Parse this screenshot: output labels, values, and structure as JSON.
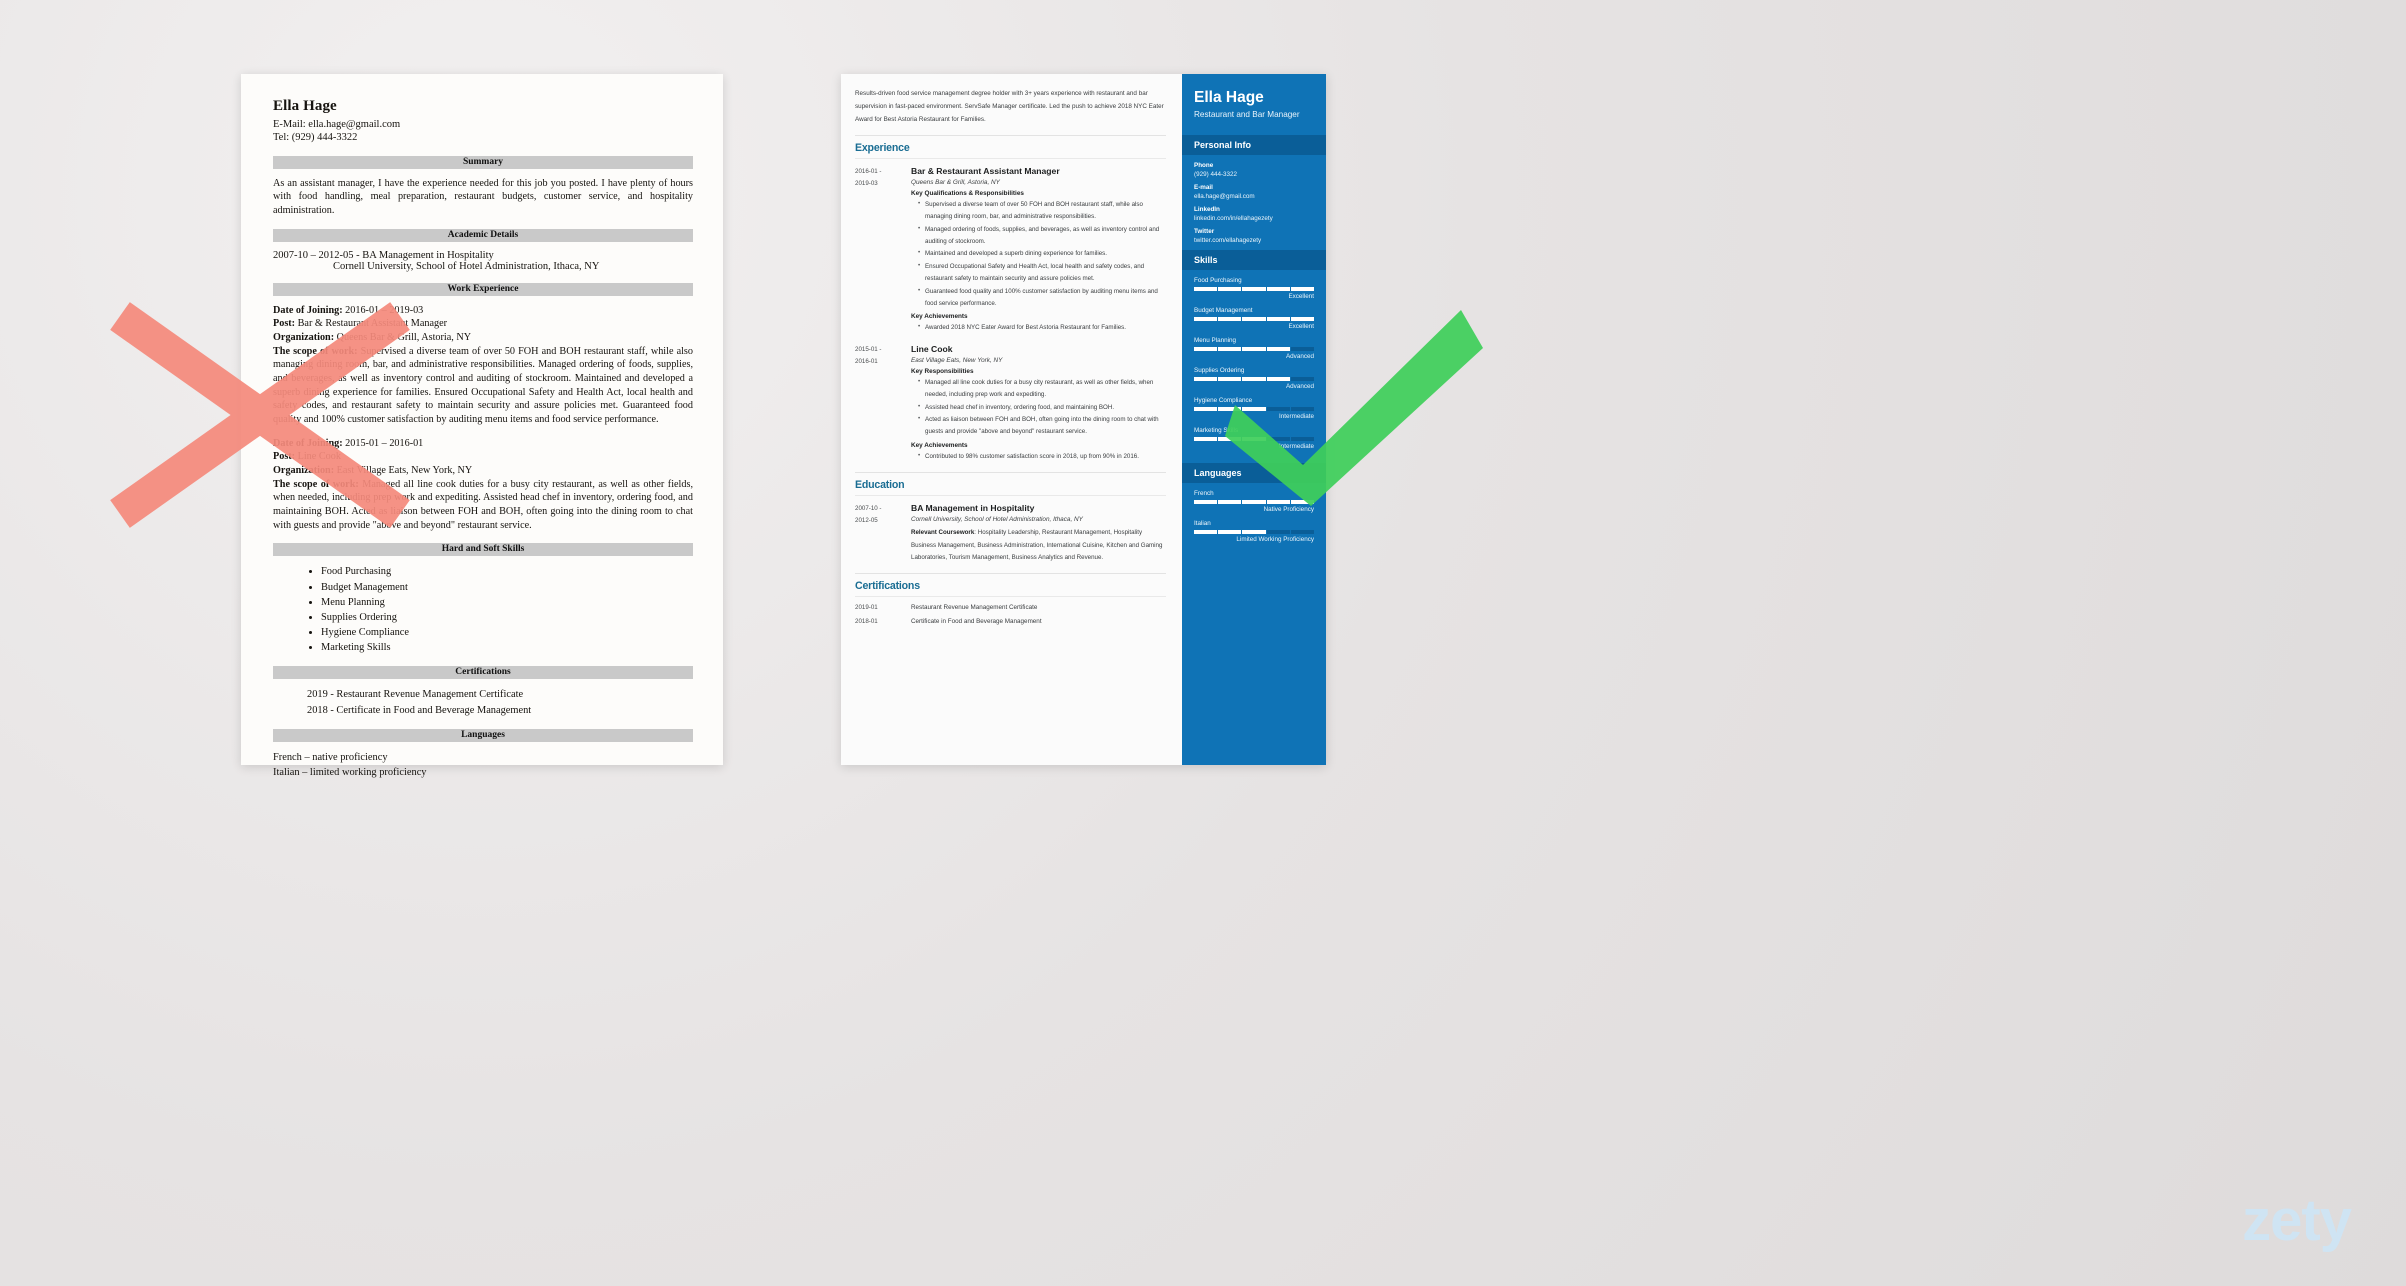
{
  "brand": {
    "wordmark": "zety",
    "color": "#cfe4f3"
  },
  "marks": {
    "reject": {
      "name": "red-x-mark",
      "color": "#f58a7c"
    },
    "approve": {
      "name": "green-check-mark",
      "color": "#3ecf5a"
    }
  },
  "bad_resume": {
    "name": "Ella Hage",
    "email_line": "E-Mail: ella.hage@gmail.com",
    "phone_line": "Tel: (929) 444-3322",
    "sections": {
      "summary": {
        "heading": "Summary",
        "text": "As an assistant manager, I have the experience needed for this job you posted. I have plenty of hours with food handling, meal preparation, restaurant budgets, customer service, and hospitality administration."
      },
      "academic": {
        "heading": "Academic Details",
        "line": "2007-10 – 2012-05  - BA Management in Hospitality",
        "sub": "Cornell University, School of Hotel Administration, Ithaca, NY"
      },
      "work": {
        "heading": "Work Experience",
        "jobs": [
          {
            "date_label": "Date of Joining:",
            "date_value": " 2016-01 – 2019-03",
            "post_label": "Post:",
            "post_value": " Bar & Restaurant Assistant Manager",
            "org_label": "Organization:",
            "org_value": " Queens Bar & Grill, Astoria, NY",
            "scope_label": "The scope of work:",
            "scope_value": " Supervised a diverse team of over 50 FOH and BOH restaurant staff, while also managing dining room, bar, and administrative responsibilities. Managed ordering of foods, supplies, and beverages, as well as inventory control and auditing of stockroom. Maintained and developed a superb dining experience for families. Ensured Occupational Safety and Health Act, local health and safety codes, and restaurant safety to maintain security and assure policies met. Guaranteed food quality and 100% customer satisfaction by auditing menu items and food service performance."
          },
          {
            "date_label": "Date of Joining:",
            "date_value": " 2015-01 – 2016-01",
            "post_label": "Post:",
            "post_value": " Line Cook",
            "org_label": "Organization:",
            "org_value": " East Village Eats, New York, NY",
            "scope_label": "The scope of work:",
            "scope_value": " Managed all line cook duties for a busy city restaurant, as well as other fields, when needed, including prep work and expediting. Assisted head chef in inventory, ordering food, and maintaining BOH. Acted as liaison between FOH and BOH, often going into the dining room to chat with guests and provide \"above and beyond\" restaurant service."
          }
        ]
      },
      "skills": {
        "heading": "Hard and Soft Skills",
        "items": [
          "Food Purchasing",
          "Budget Management",
          "Menu Planning",
          "Supplies Ordering",
          "Hygiene Compliance",
          "Marketing Skills"
        ]
      },
      "certifications": {
        "heading": "Certifications",
        "items": [
          "2019 - Restaurant Revenue Management Certificate",
          "2018 - Certificate in Food and Beverage Management"
        ]
      },
      "languages": {
        "heading": "Languages",
        "items": [
          "French – native proficiency",
          "Italian – limited working proficiency"
        ]
      }
    }
  },
  "good_resume": {
    "summary": "Results-driven food service management degree holder with 3+ years experience with restaurant and bar supervision in fast-paced environment. ServSafe Manager certificate. Led the push to achieve 2018 NYC Eater Award for Best Astoria Restaurant for Families.",
    "experience": {
      "heading": "Experience",
      "entries": [
        {
          "dates": "2016-01 -\n2019-03",
          "title": "Bar & Restaurant Assistant Manager",
          "org": "Queens Bar & Grill, Astoria, NY",
          "group1_head": "Key Qualifications & Responsibilities",
          "group1": [
            "Supervised a diverse team of over 50 FOH and BOH restaurant staff, while also managing dining room, bar, and administrative responsibilities.",
            "Managed ordering of foods, supplies, and beverages, as well as inventory control and auditing of stockroom.",
            "Maintained and developed a superb dining experience for families.",
            "Ensured Occupational Safety and Health Act, local health and safety codes, and restaurant safety to maintain security and assure policies met.",
            "Guaranteed food quality and 100% customer satisfaction by auditing menu items and food service performance."
          ],
          "group2_head": "Key Achievements",
          "group2": [
            "Awarded 2018 NYC Eater Award for Best Astoria Restaurant for Families."
          ]
        },
        {
          "dates": "2015-01 -\n2016-01",
          "title": "Line Cook",
          "org": "East Village Eats, New York, NY",
          "group1_head": "Key Responsibilities",
          "group1": [
            "Managed all line cook duties for a busy city restaurant, as well as other fields, when needed, including prep work and expediting.",
            "Assisted head chef in inventory, ordering food, and maintaining BOH.",
            "Acted as liaison between FOH and BOH, often going into the dining room to chat with guests and provide \"above and beyond\" restaurant service."
          ],
          "group2_head": "Key Achievements",
          "group2": [
            "Contributed to 98% customer satisfaction score in 2018, up from 90% in 2016."
          ]
        }
      ]
    },
    "education": {
      "heading": "Education",
      "entries": [
        {
          "dates": "2007-10 -\n2012-05",
          "title": "BA Management in Hospitality",
          "org": "Cornell University, School of Hotel Administration, Ithaca, NY",
          "coursework_label": "Relevant Coursework",
          "coursework": ": Hospitality Leadership, Restaurant Management, Hospitality Business Management, Business Administration, International Cuisine, Kitchen and Gaming Laboratories, Tourism Management, Business Analytics and Revenue."
        }
      ]
    },
    "certifications": {
      "heading": "Certifications",
      "rows": [
        {
          "date": "2019-01",
          "text": "Restaurant Revenue Management Certificate"
        },
        {
          "date": "2018-01",
          "text": "Certificate in Food and Beverage Management"
        }
      ]
    },
    "sidebar": {
      "name": "Ella Hage",
      "role": "Restaurant and Bar Manager",
      "personal_info": {
        "heading": "Personal Info",
        "fields": [
          {
            "label": "Phone",
            "value": "(929) 444-3322"
          },
          {
            "label": "E-mail",
            "value": "ella.hage@gmail.com"
          },
          {
            "label": "LinkedIn",
            "value": "linkedin.com/in/ellahagezety"
          },
          {
            "label": "Twitter",
            "value": "twitter.com/ellahagezety"
          }
        ]
      },
      "skills": {
        "heading": "Skills",
        "items": [
          {
            "name": "Food Purchasing",
            "level": "Excellent",
            "pct": 100
          },
          {
            "name": "Budget Management",
            "level": "Excellent",
            "pct": 100
          },
          {
            "name": "Menu Planning",
            "level": "Advanced",
            "pct": 80
          },
          {
            "name": "Supplies Ordering",
            "level": "Advanced",
            "pct": 80
          },
          {
            "name": "Hygiene Compliance",
            "level": "Intermediate",
            "pct": 60
          },
          {
            "name": "Marketing Skills",
            "level": "Intermediate",
            "pct": 60
          }
        ]
      },
      "languages": {
        "heading": "Languages",
        "items": [
          {
            "name": "French",
            "level": "Native Proficiency",
            "pct": 100
          },
          {
            "name": "Italian",
            "level": "Limited Working Proficiency",
            "pct": 60
          }
        ]
      }
    }
  }
}
